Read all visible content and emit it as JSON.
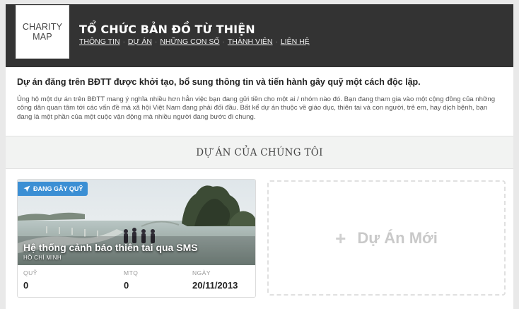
{
  "header": {
    "logo_line1": "CHARITY",
    "logo_line2": "MAP",
    "title": "TỔ CHỨC BẢN ĐỒ TỪ THIỆN",
    "nav": [
      {
        "label": "THÔNG TIN"
      },
      {
        "label": "DỰ ÁN"
      },
      {
        "label": "NHỮNG CON SỐ"
      },
      {
        "label": "THÀNH VIÊN"
      },
      {
        "label": "LIÊN HỆ"
      }
    ],
    "nav_separator": "·"
  },
  "intro": {
    "title": "Dự án đăng trên BĐTT được khởi tạo, bổ sung thông tin và tiến hành gây quỹ một cách độc lập.",
    "body": "Ủng hộ một dự án trên BĐTT mang ý nghĩa nhiều hơn hẳn việc bạn đang gửi tiền cho một ai / nhóm nào đó. Bạn đang tham gia vào một cộng đồng của những công dân quan tâm tới các vấn đề mà xã hội Việt Nam đang phải đối đầu. Bất kể dự án thuộc về giáo dục, thiên tai và con người, trẻ em, hay dịch bệnh, bạn đang là một phần của một cuộc vận động mà nhiều người đang bước đi chung."
  },
  "section": {
    "title": "DỰ ÁN CỦA CHÚNG TÔI"
  },
  "project": {
    "badge": "ĐANG GÂY QUỸ",
    "badge_icon": "paper-plane-icon",
    "title": "Hệ thống cảnh báo thiên tai qua SMS",
    "location": "HỒ CHÍ MINH",
    "stats": {
      "fund_label": "QUỸ",
      "fund_value": "0",
      "mtq_label": "MTQ",
      "mtq_value": "0",
      "date_label": "NGÀY",
      "date_value": "20/11/2013"
    }
  },
  "new_project": {
    "icon": "plus-icon",
    "label": "Dự Án Mới"
  },
  "colors": {
    "header_bg": "#333333",
    "badge_bg": "#3b8fd4",
    "section_bg": "#f2f3f2"
  }
}
